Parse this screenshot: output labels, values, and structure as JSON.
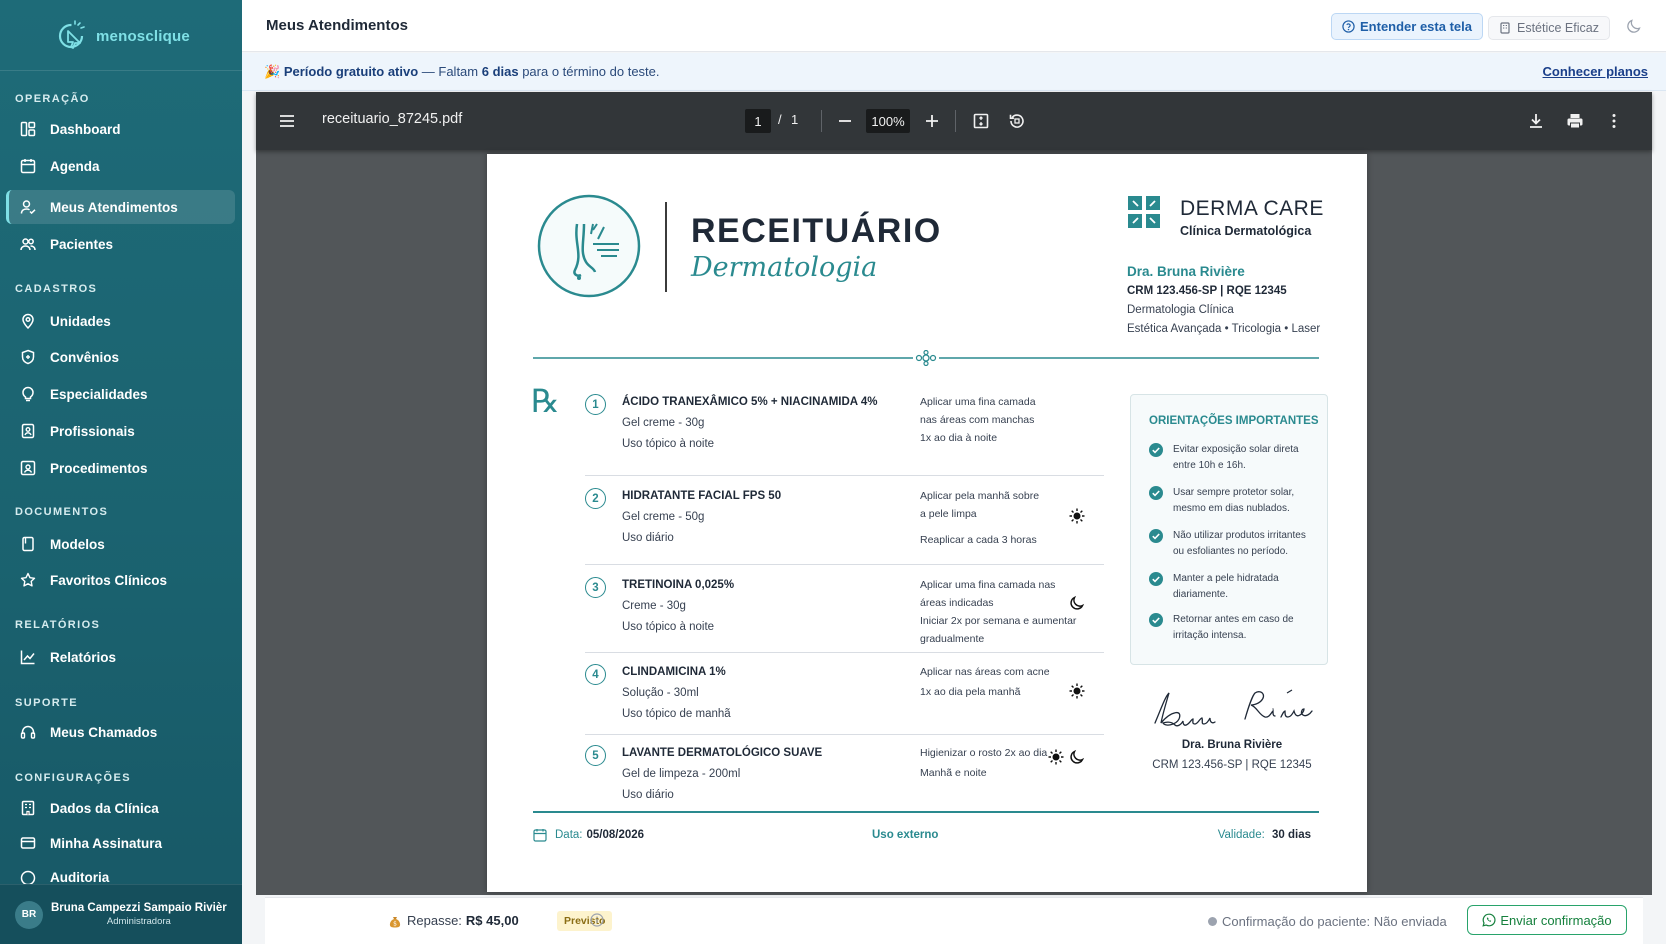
{
  "app": {
    "brand": "menosclique"
  },
  "sidebar": {
    "sections": [
      {
        "title": "OPERAÇÃO",
        "items": [
          {
            "label": "Dashboard",
            "icon": "dashboard-icon"
          },
          {
            "label": "Agenda",
            "icon": "calendar-icon"
          },
          {
            "label": "Meus Atendimentos",
            "icon": "user-check-icon",
            "active": true
          },
          {
            "label": "Pacientes",
            "icon": "users-icon"
          }
        ]
      },
      {
        "title": "CADASTROS",
        "items": [
          {
            "label": "Unidades",
            "icon": "location-pin-icon"
          },
          {
            "label": "Convênios",
            "icon": "shield-icon"
          },
          {
            "label": "Especialidades",
            "icon": "lightbulb-icon"
          },
          {
            "label": "Profissionais",
            "icon": "id-badge-icon"
          },
          {
            "label": "Procedimentos",
            "icon": "procedure-icon"
          }
        ]
      },
      {
        "title": "DOCUMENTOS",
        "items": [
          {
            "label": "Modelos",
            "icon": "document-icon"
          },
          {
            "label": "Favoritos Clínicos",
            "icon": "star-icon"
          }
        ]
      },
      {
        "title": "RELATÓRIOS",
        "items": [
          {
            "label": "Relatórios",
            "icon": "chart-line-icon"
          }
        ]
      },
      {
        "title": "SUPORTE",
        "items": [
          {
            "label": "Meus Chamados",
            "icon": "headset-icon"
          }
        ]
      },
      {
        "title": "CONFIGURAÇÕES",
        "items": [
          {
            "label": "Dados da Clínica",
            "icon": "building-icon"
          },
          {
            "label": "Minha Assinatura",
            "icon": "credit-card-icon"
          },
          {
            "label": "Auditoria",
            "icon": "audit-icon"
          }
        ]
      }
    ],
    "user": {
      "initials": "BR",
      "name": "Bruna Campezzi Sampaio Rivièr",
      "role": "Administradora"
    }
  },
  "header": {
    "title": "Meus Atendimentos",
    "help_button": "Entender esta tela",
    "clinic_button": "Estétice Eficaz"
  },
  "trial": {
    "emoji": "🎉",
    "label": "Período gratuito ativo",
    "dash": " — Faltam ",
    "days": "6 dias",
    "rest": " para o término do teste.",
    "link": "Conhecer planos"
  },
  "pdf": {
    "filename": "receituario_87245.pdf",
    "page_current": "1",
    "page_sep": "/",
    "page_total": "1",
    "zoom": "100%"
  },
  "document": {
    "title": "RECEITUÁRIO",
    "subtitle": "Dermatologia",
    "clinic_name": "DERMA CARE",
    "clinic_sub": "Clínica Dermatológica",
    "doctor_name": "Dra. Bruna Rivière",
    "doctor_crm": "CRM 123.456-SP | RQE 12345",
    "doctor_spec1": "Dermatologia Clínica",
    "doctor_spec2": "Estética Avançada • Tricologia • Laser",
    "rx": "℞",
    "medications": [
      {
        "num": "1",
        "name": "ÁCIDO TRANEXÂMICO 5% + NIACINAMIDA 4%",
        "form": "Gel creme - 30g",
        "use": "Uso tópico à noite",
        "instructions": [
          "Aplicar uma fina camada",
          "nas áreas com manchas",
          "1x ao dia à noite"
        ],
        "icons": []
      },
      {
        "num": "2",
        "name": "HIDRATANTE FACIAL FPS 50",
        "form": "Gel creme - 50g",
        "use": "Uso diário",
        "instructions": [
          "Aplicar pela manhã sobre",
          "a pele limpa",
          "Reaplicar a cada 3 horas"
        ],
        "icons": [
          "sun-icon"
        ]
      },
      {
        "num": "3",
        "name": "TRETINOINA 0,025%",
        "form": "Creme - 30g",
        "use": "Uso tópico à noite",
        "instructions": [
          "Aplicar uma fina camada nas",
          "áreas indicadas",
          "Iniciar 2x por semana e aumentar",
          "gradualmente"
        ],
        "icons": [
          "moon-icon"
        ]
      },
      {
        "num": "4",
        "name": "CLINDAMICINA 1%",
        "form": "Solução - 30ml",
        "use": "Uso tópico de manhã",
        "instructions": [
          "Aplicar nas áreas com acne",
          "1x ao dia pela manhã"
        ],
        "icons": [
          "sun-icon"
        ]
      },
      {
        "num": "5",
        "name": "LAVANTE DERMATOLÓGICO SUAVE",
        "form": "Gel de limpeza - 200ml",
        "use": "Uso diário",
        "instructions": [
          "Higienizar o rosto 2x ao dia",
          "Manhã e noite"
        ],
        "icons": [
          "sun-icon",
          "moon-icon"
        ]
      }
    ],
    "orientations": {
      "title": "ORIENTAÇÕES IMPORTANTES",
      "items": [
        [
          "Evitar exposição solar direta",
          "entre 10h e 16h."
        ],
        [
          "Usar sempre protetor solar,",
          "mesmo em dias nublados."
        ],
        [
          "Não utilizar produtos irritantes",
          "ou esfoliantes no período."
        ],
        [
          "Manter a pele hidratada",
          "diariamente."
        ],
        [
          "Retornar antes em caso de",
          "irritação intensa."
        ]
      ]
    },
    "signature": {
      "name": "Dra. Bruna Rivière",
      "crm": "CRM 123.456-SP | RQE 12345"
    },
    "footer": {
      "date_label": "Data:",
      "date": "05/08/2026",
      "use": "Uso externo",
      "validity_label": "Validade:",
      "validity": "30 dias"
    }
  },
  "bottom": {
    "repasse_label": "Repasse:",
    "repasse_value": "R$ 45,00",
    "badge": "Previsto",
    "confirmation": "Confirmação do paciente: Não enviada",
    "send_button": "Enviar confirmação"
  },
  "colors": {
    "sidebar": "#1b6370",
    "accent": "#2a8a8f",
    "link": "#1a3f8a"
  }
}
